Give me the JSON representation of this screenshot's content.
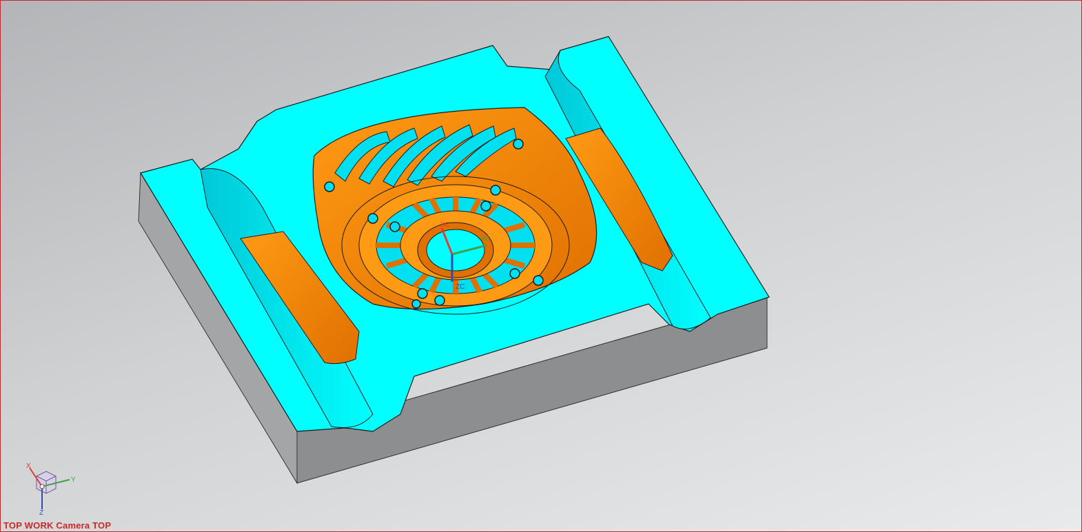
{
  "viewport": {
    "view_label": "TOP WORK Camera TOP",
    "work_csys": {
      "x_label": "XC",
      "y_label": "YC",
      "z_label": "ZC"
    },
    "view_triad": {
      "x_label": "X",
      "y_label": "Y",
      "z_label": "Z"
    }
  },
  "colors": {
    "background_top": "#b3b5b8",
    "background_bottom": "#e9eaec",
    "viewport_border": "#c0282c",
    "part_top_face": "#00ffff",
    "part_pocket_face": "#ff8a00",
    "part_side_face": "#8c8e90",
    "x_axis": "#e53935",
    "y_axis": "#43a047",
    "z_axis": "#3949ab"
  },
  "icons": {
    "work_csys": "coordinate-system-icon",
    "view_triad": "orientation-triad-icon"
  }
}
